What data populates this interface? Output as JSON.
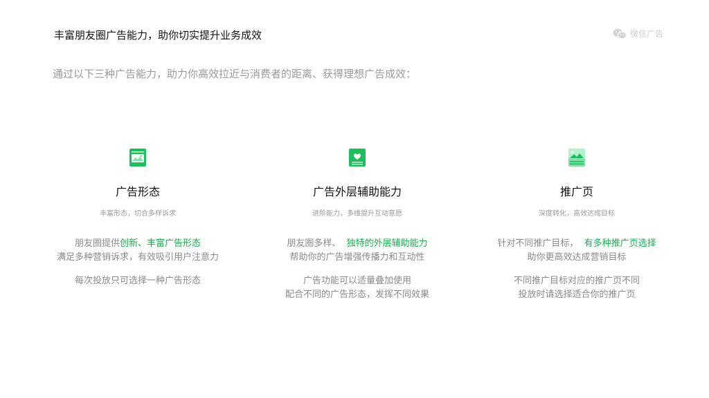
{
  "header": {
    "title": "丰富朋友圈广告能力，助你切实提升业务成效",
    "brand": "微信广告",
    "brand_icon": "wechat-icon"
  },
  "intro": "通过以下三种广告能力，助力你高效拉近与消费者的距离、获得理想广告成效：",
  "colors": {
    "accent": "#1aad50",
    "icon_green": "#1fbe5c",
    "muted": "#9a9a9a"
  },
  "columns": [
    {
      "icon": "ad-format-icon",
      "title": "广告形态",
      "subtitle": "丰富形态，切合多样诉求",
      "line1_prefix": "朋友圈提供",
      "line1_highlight": "创新、丰富广告形态",
      "line2": "满足多种营销诉求，有效吸引用户注意力",
      "line3": "每次投放只可选择一种广告形态",
      "line4": ""
    },
    {
      "icon": "heart-card-icon",
      "title": "广告外层辅助能力",
      "subtitle": "进阶能力，多维提升互动意愿",
      "line1_prefix": "朋友圈多样、",
      "line1_highlight": "独特的外层辅助能力",
      "line2": "帮助你的广告增强传播力和互动性",
      "line3": "广告功能可以适量叠加使用",
      "line4": "配合不同的广告形态，发挥不同效果"
    },
    {
      "icon": "landing-page-icon",
      "title": "推广页",
      "subtitle": "深度转化，高效达成目标",
      "line1_prefix": "针对不同推广目标，",
      "line1_highlight": "有多种推广页选择",
      "line2": "助你更高效达成营销目标",
      "line3": "不同推广目标对应的推广页不同",
      "line4": "投放时请选择适合你的推广页"
    }
  ]
}
